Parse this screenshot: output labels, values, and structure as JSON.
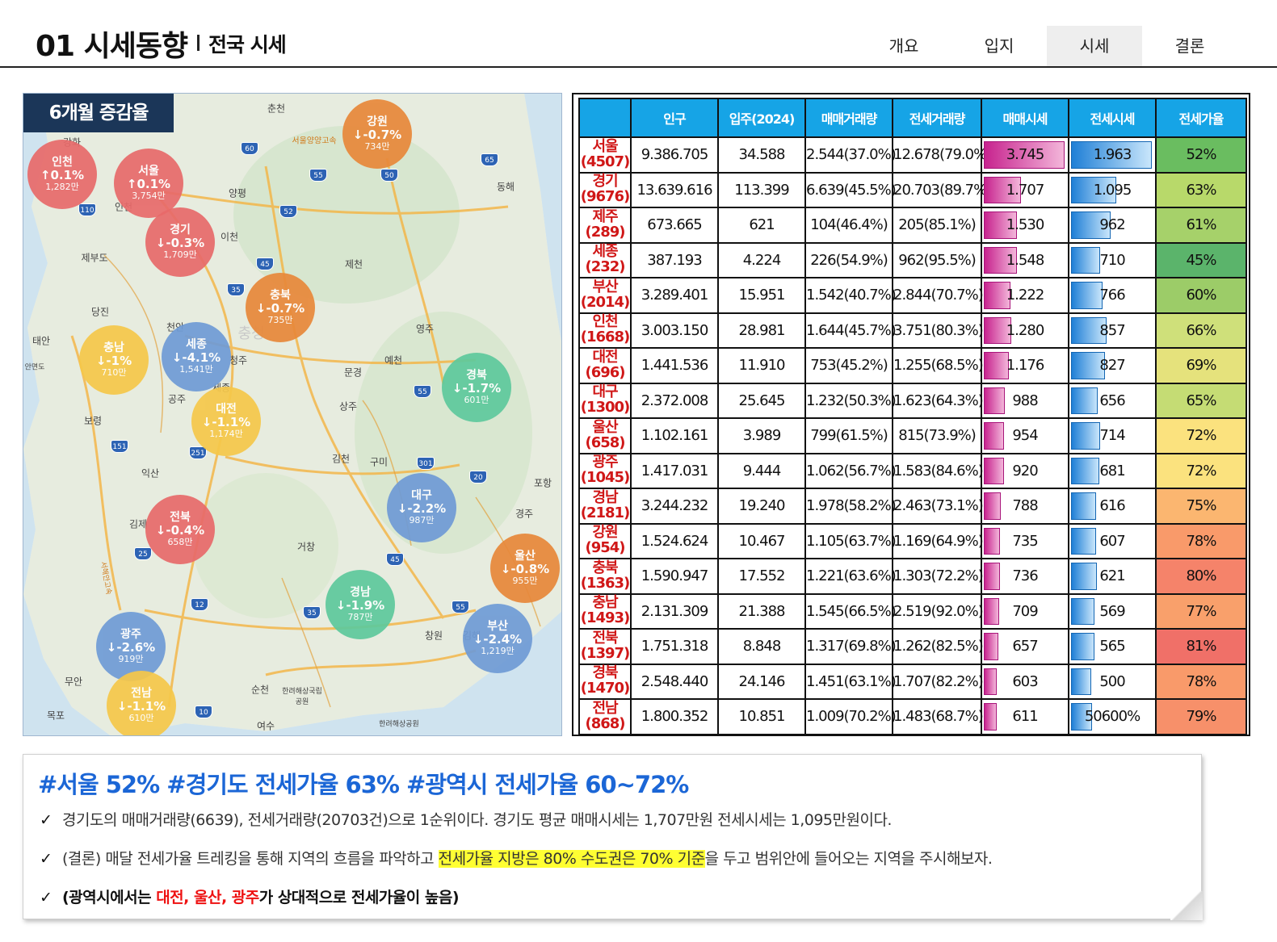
{
  "header": {
    "title": "01 시세동향",
    "subtitle": "전국 시세",
    "tabs": [
      {
        "label": "개요",
        "active": false
      },
      {
        "label": "입지",
        "active": false
      },
      {
        "label": "시세",
        "active": true
      },
      {
        "label": "결론",
        "active": false
      }
    ]
  },
  "map": {
    "badge": "6개월 증감율",
    "places": [
      {
        "name": "강화"
      },
      {
        "name": "춘천"
      },
      {
        "name": "서울양양고속"
      },
      {
        "name": "동해"
      },
      {
        "name": "양평"
      },
      {
        "name": "이천"
      },
      {
        "name": "제부도"
      },
      {
        "name": "제천"
      },
      {
        "name": "당진"
      },
      {
        "name": "천안"
      },
      {
        "name": "태안"
      },
      {
        "name": "안면도"
      },
      {
        "name": "청주"
      },
      {
        "name": "세종"
      },
      {
        "name": "영주"
      },
      {
        "name": "예천"
      },
      {
        "name": "문경"
      },
      {
        "name": "공주"
      },
      {
        "name": "상주"
      },
      {
        "name": "보령"
      },
      {
        "name": "김천"
      },
      {
        "name": "구미"
      },
      {
        "name": "포항"
      },
      {
        "name": "익산"
      },
      {
        "name": "김제"
      },
      {
        "name": "경주"
      },
      {
        "name": "거창"
      },
      {
        "name": "창원"
      },
      {
        "name": "김해"
      },
      {
        "name": "무안"
      },
      {
        "name": "순천"
      },
      {
        "name": "목포"
      },
      {
        "name": "여수"
      },
      {
        "name": "한려해상국립공원"
      },
      {
        "name": "한려해상공원"
      },
      {
        "name": "인천"
      },
      {
        "name": "충청"
      },
      {
        "name": "서해안고속"
      }
    ],
    "shields": [
      "60",
      "55",
      "50",
      "65",
      "110",
      "52",
      "45",
      "35",
      "55",
      "301",
      "20",
      "151",
      "251",
      "45",
      "25",
      "12",
      "35",
      "55",
      "10"
    ],
    "bubbles": [
      {
        "name": "인천",
        "rate": "↑0.1%",
        "price": "1,282만",
        "color": "#e86a6a"
      },
      {
        "name": "서울",
        "rate": "↑0.1%",
        "price": "3,754만",
        "color": "#e86a6a"
      },
      {
        "name": "경기",
        "rate": "↓-0.3%",
        "price": "1,709만",
        "color": "#e86a6a"
      },
      {
        "name": "강원",
        "rate": "↓-0.7%",
        "price": "734만",
        "color": "#e8883a"
      },
      {
        "name": "충북",
        "rate": "↓-0.7%",
        "price": "735만",
        "color": "#e8883a"
      },
      {
        "name": "충남",
        "rate": "↓-1%",
        "price": "710만",
        "color": "#f6c84a"
      },
      {
        "name": "세종",
        "rate": "↓-4.1%",
        "price": "1,541만",
        "color": "#6f9bd6"
      },
      {
        "name": "대전",
        "rate": "↓-1.1%",
        "price": "1,174만",
        "color": "#f6c84a"
      },
      {
        "name": "경북",
        "rate": "↓-1.7%",
        "price": "601만",
        "color": "#5ec99c"
      },
      {
        "name": "대구",
        "rate": "↓-2.2%",
        "price": "987만",
        "color": "#6f9bd6"
      },
      {
        "name": "전북",
        "rate": "↓-0.4%",
        "price": "658만",
        "color": "#e86a6a"
      },
      {
        "name": "울산",
        "rate": "↓-0.8%",
        "price": "955만",
        "color": "#e8883a"
      },
      {
        "name": "경남",
        "rate": "↓-1.9%",
        "price": "787만",
        "color": "#5ec99c"
      },
      {
        "name": "광주",
        "rate": "↓-2.6%",
        "price": "919만",
        "color": "#6f9bd6"
      },
      {
        "name": "부산",
        "rate": "↓-2.4%",
        "price": "1,219만",
        "color": "#6f9bd6"
      },
      {
        "name": "전남",
        "rate": "↓-1.1%",
        "price": "610만",
        "color": "#f6c84a"
      }
    ]
  },
  "table": {
    "columns": [
      "",
      "인구",
      "입주(2024)",
      "매매거래량",
      "전세거래량",
      "매매시세",
      "전세시세",
      "전세가율"
    ],
    "rows": [
      {
        "region": "서울",
        "code": "(4507)",
        "pop": "9.386.705",
        "move": "34.588",
        "sale_vol": "2.544(37.0%)",
        "jeonse_vol": "12.678(79.0%)",
        "sale_price": "3.745",
        "sale_level": 3745,
        "jeonse_price": "1.963",
        "jeonse_level": 1963,
        "ratio": "52%",
        "ratio_color": "#6abd60"
      },
      {
        "region": "경기",
        "code": "(9676)",
        "pop": "13.639.616",
        "move": "113.399",
        "sale_vol": "6.639(45.5%)",
        "jeonse_vol": "20.703(89.7%)",
        "sale_price": "1.707",
        "sale_level": 1707,
        "jeonse_price": "1.095",
        "jeonse_level": 1095,
        "ratio": "63%",
        "ratio_color": "#b8d96a"
      },
      {
        "region": "제주",
        "code": "(289)",
        "pop": "673.665",
        "move": "621",
        "sale_vol": "104(46.4%)",
        "jeonse_vol": "205(85.1%)",
        "sale_price": "1.530",
        "sale_level": 1530,
        "jeonse_price": "962",
        "jeonse_level": 962,
        "ratio": "61%",
        "ratio_color": "#a6d16a"
      },
      {
        "region": "세종",
        "code": "(232)",
        "pop": "387.193",
        "move": "4.224",
        "sale_vol": "226(54.9%)",
        "jeonse_vol": "962(95.5%)",
        "sale_price": "1.548",
        "sale_level": 1548,
        "jeonse_price": "710",
        "jeonse_level": 710,
        "ratio": "45%",
        "ratio_color": "#5bb46b"
      },
      {
        "region": "부산",
        "code": "(2014)",
        "pop": "3.289.401",
        "move": "15.951",
        "sale_vol": "1.542(40.7%)",
        "jeonse_vol": "2.844(70.7%)",
        "sale_price": "1.222",
        "sale_level": 1222,
        "jeonse_price": "766",
        "jeonse_level": 766,
        "ratio": "60%",
        "ratio_color": "#9ccc68"
      },
      {
        "region": "인천",
        "code": "(1668)",
        "pop": "3.003.150",
        "move": "28.981",
        "sale_vol": "1.644(45.7%)",
        "jeonse_vol": "3.751(80.3%)",
        "sale_price": "1.280",
        "sale_level": 1280,
        "jeonse_price": "857",
        "jeonse_level": 857,
        "ratio": "66%",
        "ratio_color": "#cfe07a"
      },
      {
        "region": "대전",
        "code": "(696)",
        "pop": "1.441.536",
        "move": "11.910",
        "sale_vol": "753(45.2%)",
        "jeonse_vol": "1.255(68.5%)",
        "sale_price": "1.176",
        "sale_level": 1176,
        "jeonse_price": "827",
        "jeonse_level": 827,
        "ratio": "69%",
        "ratio_color": "#e5e27c"
      },
      {
        "region": "대구",
        "code": "(1300)",
        "pop": "2.372.008",
        "move": "25.645",
        "sale_vol": "1.232(50.3%)",
        "jeonse_vol": "1.623(64.3%)",
        "sale_price": "988",
        "sale_level": 988,
        "jeonse_price": "656",
        "jeonse_level": 656,
        "ratio": "65%",
        "ratio_color": "#c5dc74"
      },
      {
        "region": "울산",
        "code": "(658)",
        "pop": "1.102.161",
        "move": "3.989",
        "sale_vol": "799(61.5%)",
        "jeonse_vol": "815(73.9%)",
        "sale_price": "954",
        "sale_level": 954,
        "jeonse_price": "714",
        "jeonse_level": 714,
        "ratio": "72%",
        "ratio_color": "#fbe27e"
      },
      {
        "region": "광주",
        "code": "(1045)",
        "pop": "1.417.031",
        "move": "9.444",
        "sale_vol": "1.062(56.7%)",
        "jeonse_vol": "1.583(84.6%)",
        "sale_price": "920",
        "sale_level": 920,
        "jeonse_price": "681",
        "jeonse_level": 681,
        "ratio": "72%",
        "ratio_color": "#fbe27e"
      },
      {
        "region": "경남",
        "code": "(2181)",
        "pop": "3.244.232",
        "move": "19.240",
        "sale_vol": "1.978(58.2%)",
        "jeonse_vol": "2.463(73.1%)",
        "sale_price": "788",
        "sale_level": 788,
        "jeonse_price": "616",
        "jeonse_level": 616,
        "ratio": "75%",
        "ratio_color": "#fbb670"
      },
      {
        "region": "강원",
        "code": "(954)",
        "pop": "1.524.624",
        "move": "10.467",
        "sale_vol": "1.105(63.7%)",
        "jeonse_vol": "1.169(64.9%)",
        "sale_price": "735",
        "sale_level": 735,
        "jeonse_price": "607",
        "jeonse_level": 607,
        "ratio": "78%",
        "ratio_color": "#f99a6a"
      },
      {
        "region": "충북",
        "code": "(1363)",
        "pop": "1.590.947",
        "move": "17.552",
        "sale_vol": "1.221(63.6%)",
        "jeonse_vol": "1.303(72.2%)",
        "sale_price": "736",
        "sale_level": 736,
        "jeonse_price": "621",
        "jeonse_level": 621,
        "ratio": "80%",
        "ratio_color": "#f5836a"
      },
      {
        "region": "충남",
        "code": "(1493)",
        "pop": "2.131.309",
        "move": "21.388",
        "sale_vol": "1.545(66.5%)",
        "jeonse_vol": "2.519(92.0%)",
        "sale_price": "709",
        "sale_level": 709,
        "jeonse_price": "569",
        "jeonse_level": 569,
        "ratio": "77%",
        "ratio_color": "#f9a06b"
      },
      {
        "region": "전북",
        "code": "(1397)",
        "pop": "1.751.318",
        "move": "8.848",
        "sale_vol": "1.317(69.8%)",
        "jeonse_vol": "1.262(82.5%)",
        "sale_price": "657",
        "sale_level": 657,
        "jeonse_price": "565",
        "jeonse_level": 565,
        "ratio": "81%",
        "ratio_color": "#f07068"
      },
      {
        "region": "경북",
        "code": "(1470)",
        "pop": "2.548.440",
        "move": "24.146",
        "sale_vol": "1.451(63.1%)",
        "jeonse_vol": "1.707(82.2%)",
        "sale_price": "603",
        "sale_level": 603,
        "jeonse_price": "500",
        "jeonse_level": 500,
        "ratio": "78%",
        "ratio_color": "#f99a6a"
      },
      {
        "region": "전남",
        "code": "(868)",
        "pop": "1.800.352",
        "move": "10.851",
        "sale_vol": "1.009(70.2%)",
        "jeonse_vol": "1.483(68.7%)",
        "sale_price": "611",
        "sale_level": 611,
        "jeonse_price": "50600%",
        "jeonse_level": 506,
        "ratio": "79%",
        "ratio_color": "#f7906a"
      }
    ]
  },
  "summary": {
    "headline": "#서울 52% #경기도 전세가율 63% #광역시 전세가율 60~72%",
    "bullet1": "경기도의 매매거래량(6639), 전세거래량(20703건)으로 1순위이다. 경기도 평균 매매시세는 1,707만원 전세시세는 1,095만원이다.",
    "bullet2_a": "(결론) 매달 전세가율 트레킹을 통해 지역의 흐름을 파악하고 ",
    "bullet2_hl1": "전세가율 지방은 80% 수도권은 70% 기준",
    "bullet2_b": "을 두고 범위안에 들어오는 지역을 주시해보자.",
    "bullet3_a": "(광역시에서는 ",
    "bullet3_red": "대전, 울산, 광주",
    "bullet3_b": "가 상대적으로 전세가율이 높음)",
    "check_icon": "✓"
  }
}
